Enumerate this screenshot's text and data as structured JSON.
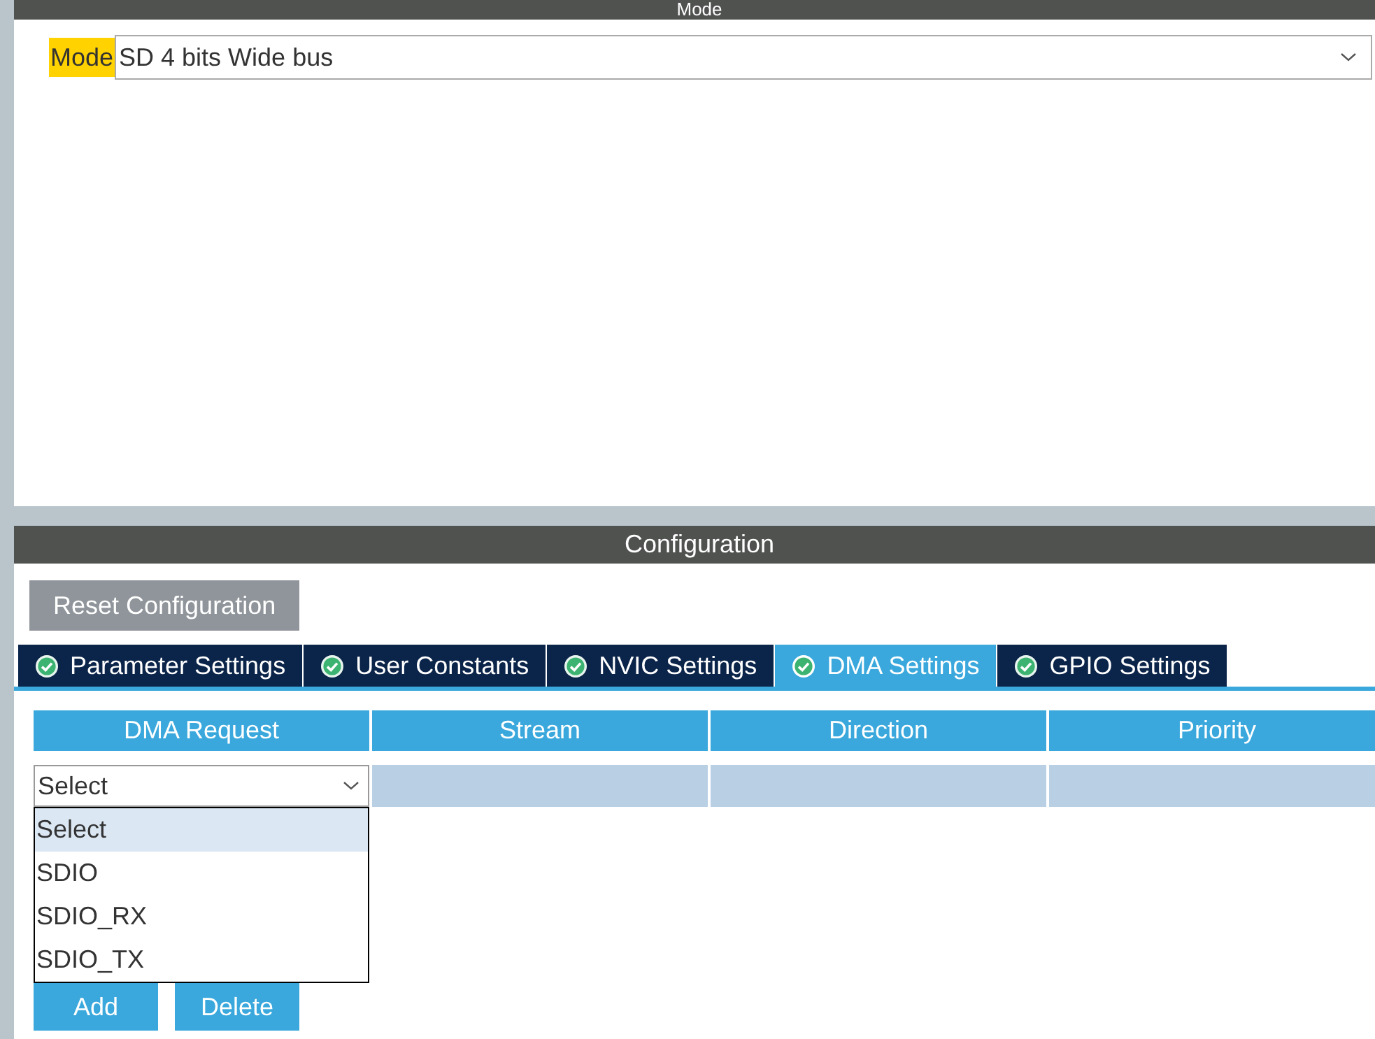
{
  "mode_panel": {
    "title": "Mode",
    "label": "Mode",
    "value": "SD 4 bits Wide bus"
  },
  "configuration": {
    "title": "Configuration",
    "reset_button": "Reset Configuration",
    "tabs": [
      {
        "label": "Parameter Settings",
        "selected": false
      },
      {
        "label": "User Constants",
        "selected": false
      },
      {
        "label": "NVIC Settings",
        "selected": false
      },
      {
        "label": "DMA Settings",
        "selected": true
      },
      {
        "label": "GPIO Settings",
        "selected": false
      }
    ],
    "table": {
      "columns": [
        "DMA Request",
        "Stream",
        "Direction",
        "Priority"
      ],
      "rows": [
        {
          "request": "Select"
        }
      ]
    },
    "dropdown": {
      "expanded": true,
      "options": [
        {
          "label": "Select",
          "selected": true
        },
        {
          "label": "SDIO",
          "selected": false
        },
        {
          "label": "SDIO_RX",
          "selected": false
        },
        {
          "label": "SDIO_TX",
          "selected": false
        }
      ]
    },
    "buttons": [
      "Add",
      "Delete"
    ]
  }
}
